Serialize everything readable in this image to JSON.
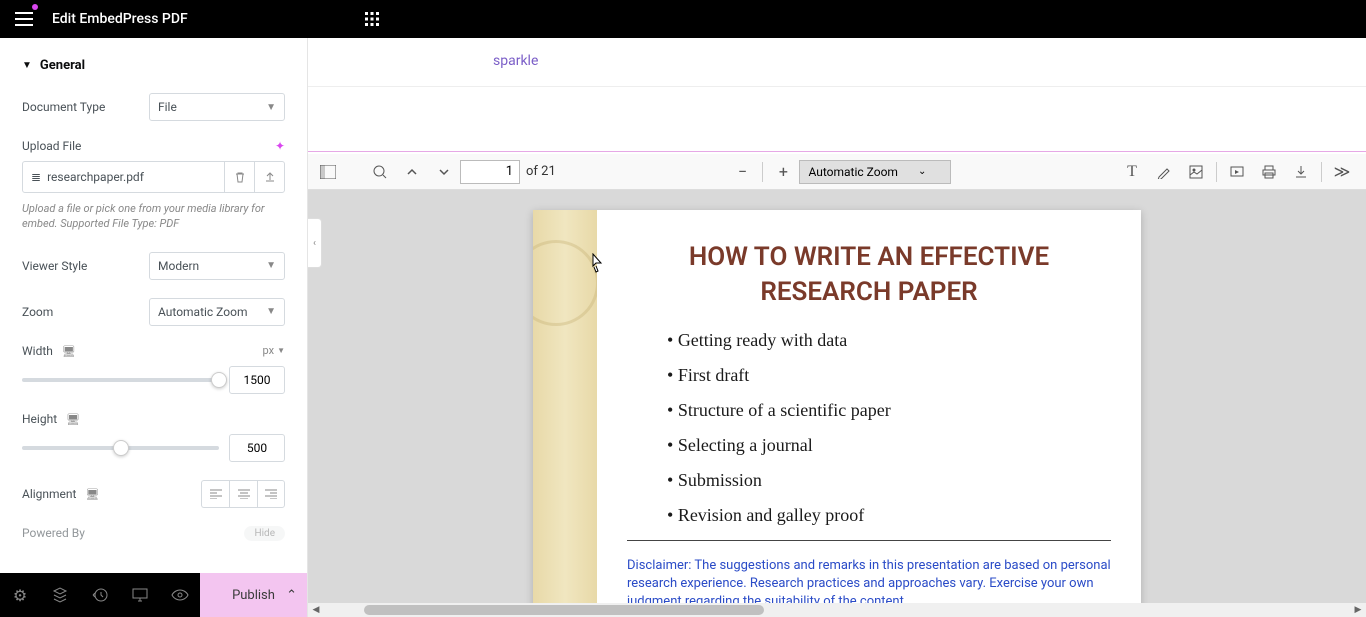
{
  "topbar": {
    "title": "Edit EmbedPress PDF"
  },
  "breadcrumb": "sparkle",
  "sidebar": {
    "section": "General",
    "document_type": {
      "label": "Document Type",
      "value": "File"
    },
    "upload_file": {
      "label": "Upload File",
      "filename": "researchpaper.pdf",
      "help": "Upload a file or pick one from your media library for embed. Supported File Type: PDF"
    },
    "viewer_style": {
      "label": "Viewer Style",
      "value": "Modern"
    },
    "zoom": {
      "label": "Zoom",
      "value": "Automatic Zoom"
    },
    "width": {
      "label": "Width",
      "unit": "px",
      "value": "1500"
    },
    "height": {
      "label": "Height",
      "value": "500"
    },
    "alignment": {
      "label": "Alignment"
    },
    "powered_by": {
      "label": "Powered By",
      "badge": "Hide"
    }
  },
  "publish": "Publish",
  "pdf_toolbar": {
    "page": "1",
    "total": "of 21",
    "zoom": "Automatic Zoom"
  },
  "pdf_content": {
    "title_line1": "HOW TO WRITE AN EFFECTIVE",
    "title_line2": "RESEARCH PAPER",
    "bullets": [
      "Getting ready with data",
      "First draft",
      "Structure of a scientific paper",
      "Selecting a journal",
      "Submission",
      "Revision and galley proof"
    ],
    "disclaimer": "Disclaimer: The suggestions and remarks in this presentation are based on personal research experience. Research practices and approaches vary. Exercise your own judgment regarding the suitability of the content."
  }
}
